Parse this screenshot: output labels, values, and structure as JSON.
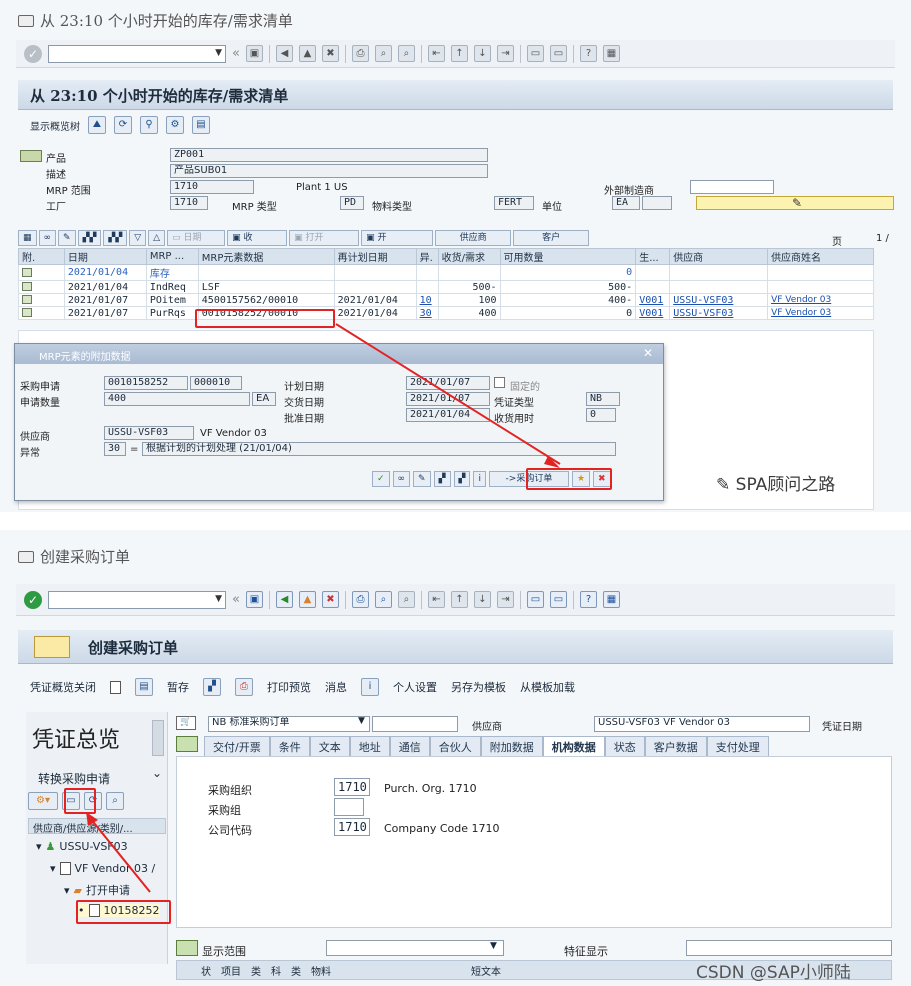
{
  "top": {
    "window_title": "从 23:10 个小时开始的库存/需求清单",
    "header_title": "从 23:10 个小时开始的库存/需求清单",
    "apptoolbar_label": "显示概览树",
    "form": {
      "product_label": "产品",
      "product_value": "ZP001",
      "desc_label": "描述",
      "desc_value": "产品SUB01",
      "mrp_area_label": "MRP 范围",
      "mrp_area_value": "1710",
      "mrp_area_text": "Plant 1 US",
      "plant_label": "工厂",
      "plant_value": "1710",
      "mrp_type_label": "MRP 类型",
      "mrp_type_value": "PD",
      "material_type_label": "物料类型",
      "material_type_value": "FERT",
      "unit_label": "单位",
      "unit_value": "EA",
      "ext_label": "外部制造商",
      "page_label": "页",
      "page_value": "1 /"
    },
    "grid_buttons": [
      "日期",
      "收",
      "打开",
      "开",
      "供应商",
      "客户"
    ],
    "columns": [
      "附.",
      "日期",
      "MRP ...",
      "MRP元素数据",
      "再计划日期",
      "异.",
      "收货/需求",
      "可用数量",
      "生...",
      "供应商",
      "供应商姓名"
    ],
    "rows": [
      {
        "date": "2021/01/04",
        "mrp": "库存",
        "data": "",
        "resched": "",
        "exc": "",
        "qty": "",
        "avail": "0",
        "prod": "",
        "vendor": "",
        "vname": ""
      },
      {
        "date": "2021/01/04",
        "mrp": "IndReq",
        "data": "LSF",
        "resched": "",
        "exc": "",
        "qty": "500-",
        "avail": "500-",
        "prod": "",
        "vendor": "",
        "vname": ""
      },
      {
        "date": "2021/01/07",
        "mrp": "POitem",
        "data": "4500157562/00010",
        "resched": "2021/01/04",
        "exc": "10",
        "qty": "100",
        "avail": "400-",
        "prod": "V001",
        "vendor": "USSU-VSF03",
        "vname": "VF Vendor 03"
      },
      {
        "date": "2021/01/07",
        "mrp": "PurRqs",
        "data": "0010158252/00010",
        "resched": "2021/01/04",
        "exc": "30",
        "qty": "400",
        "avail": "0",
        "prod": "V001",
        "vendor": "USSU-VSF03",
        "vname": "VF Vendor 03"
      }
    ],
    "dialog": {
      "title": "MRP元素的附加数据",
      "pr_label": "采购申请",
      "pr_value": "0010158252",
      "pr_item": "000010",
      "qty_label": "申请数量",
      "qty_value": "400",
      "qty_unit": "EA",
      "plan_date_label": "计划日期",
      "plan_date_value": "2021/01/07",
      "fixed_label": "固定的",
      "delivery_label": "交货日期",
      "delivery_value": "2021/01/07",
      "doc_type_label": "凭证类型",
      "doc_type_value": "NB",
      "release_label": "批准日期",
      "release_value": "2021/01/04",
      "gr_time_label": "收货用时",
      "gr_time_value": "0",
      "vendor_label": "供应商",
      "vendor_value": "USSU-VSF03",
      "vendor_name": "VF Vendor 03",
      "exc_label": "异常",
      "exc_value": "30",
      "exc_eq": "=",
      "exc_text": "根据计划的计划处理 (21/01/04)",
      "to_po_button": "->采购订单"
    }
  },
  "bottom": {
    "window_title": "创建采购订单",
    "header_title": "创建采购订单",
    "toolbar": [
      "凭证概览关闭",
      "暂存",
      "打印预览",
      "消息",
      "个人设置",
      "另存为模板",
      "从模板加载"
    ],
    "sidebar_title": "凭证总览",
    "sidebar_sub": "转换采购申请",
    "sidebar_col": "供应商/供应源/类别/...",
    "tree": {
      "vendor": "USSU-VSF03",
      "vendor_name": "VF Vendor 03 /",
      "open": "打开申请",
      "pr": "10158252"
    },
    "po_type": "NB 标准采购订单",
    "vendor_label": "供应商",
    "vendor_value": "USSU-VSF03 VF Vendor 03",
    "doc_date_label": "凭证日期",
    "tabs": [
      "交付/开票",
      "条件",
      "文本",
      "地址",
      "通信",
      "合伙人",
      "附加数据",
      "机构数据",
      "状态",
      "客户数据",
      "支付处理"
    ],
    "active_tab": "机构数据",
    "org": {
      "porg_label": "采购组织",
      "porg_value": "1710",
      "porg_text": "Purch. Org. 1710",
      "pgrp_label": "采购组",
      "cc_label": "公司代码",
      "cc_value": "1710",
      "cc_text": "Company Code 1710"
    },
    "bottom_bar": {
      "display_label": "显示范围",
      "feature_label": "特征显示"
    },
    "item_cols": [
      "状",
      "项目",
      "类",
      "科",
      "类",
      "物料",
      "短文本"
    ]
  },
  "watermarks": {
    "top": "SPA顾问之路",
    "bottom": "SPA顾问之路",
    "csdn": "CSDN @SAP小师陆"
  },
  "colors": {
    "accent_red": "#e32222",
    "header_blue": "#cdd9e7",
    "link_blue": "#1a4fb0",
    "field_yellow": "#fdf3b0"
  }
}
